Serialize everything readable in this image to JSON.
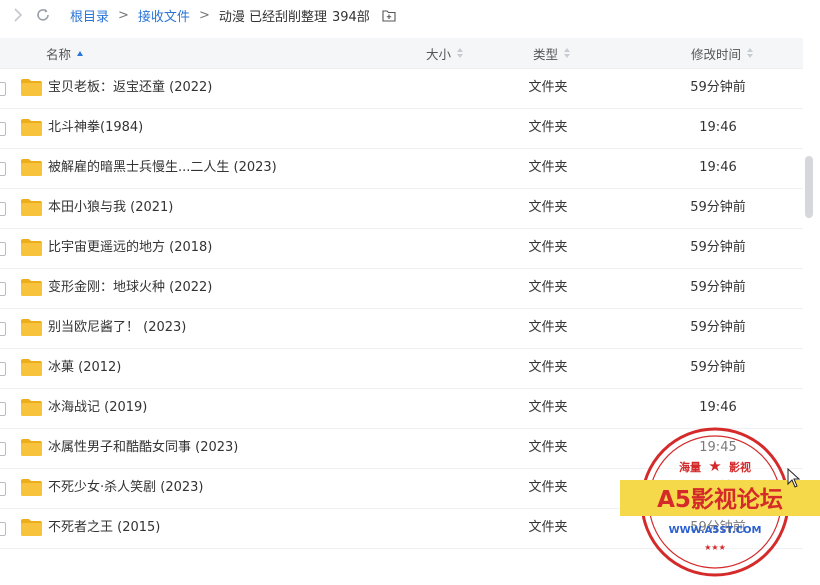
{
  "breadcrumb": {
    "root": "根目录",
    "parent": "接收文件",
    "current": "动漫 已经刮削整理",
    "count": "394部"
  },
  "columns": {
    "name": "名称",
    "size": "大小",
    "type": "类型",
    "modified": "修改时间"
  },
  "rows": [
    {
      "name": "宝贝老板：返宝还童 (2022)",
      "type": "文件夹",
      "time": "59分钟前"
    },
    {
      "name": "北斗神拳(1984)",
      "type": "文件夹",
      "time": "19:46"
    },
    {
      "name": "被解雇的暗黑士兵慢生...二人生 (2023)",
      "type": "文件夹",
      "time": "19:46"
    },
    {
      "name": "本田小狼与我 (2021)",
      "type": "文件夹",
      "time": "59分钟前"
    },
    {
      "name": "比宇宙更遥远的地方 (2018)",
      "type": "文件夹",
      "time": "59分钟前"
    },
    {
      "name": "变形金刚：地球火种 (2022)",
      "type": "文件夹",
      "time": "59分钟前"
    },
    {
      "name": "别当欧尼酱了！ (2023)",
      "type": "文件夹",
      "time": "59分钟前"
    },
    {
      "name": "冰菓 (2012)",
      "type": "文件夹",
      "time": "59分钟前"
    },
    {
      "name": "冰海战记 (2019)",
      "type": "文件夹",
      "time": "19:46"
    },
    {
      "name": "冰属性男子和酷酷女同事 (2023)",
      "type": "文件夹",
      "time": "19:45"
    },
    {
      "name": "不死少女·杀人笑剧 (2023)",
      "type": "文件夹",
      "time": "59分钟前"
    },
    {
      "name": "不死者之王 (2015)",
      "type": "文件夹",
      "time": "59分钟前"
    }
  ],
  "watermark": {
    "top_left": "海量",
    "top_right": "影视",
    "main": "A5影视论坛",
    "url": "WWW.A5ST.COM",
    "stars": "★★★"
  },
  "colors": {
    "link": "#2a75d8",
    "folder": "#f7c23c",
    "folder_tab": "#eeae1c",
    "watermark_red": "#d42a2a",
    "watermark_yellow": "#f6d94a"
  },
  "icons": {
    "forward": "chevron-right-icon",
    "refresh": "refresh-icon",
    "address": "add-folder-icon",
    "folder": "folder-icon"
  }
}
